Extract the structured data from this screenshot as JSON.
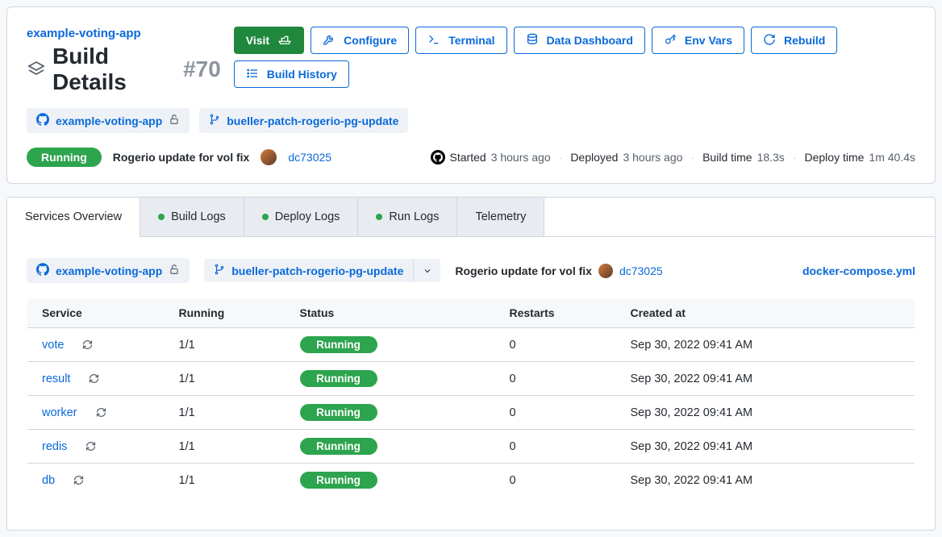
{
  "header": {
    "app_name": "example-voting-app",
    "title": "Build Details",
    "build_number": "#70"
  },
  "actions": {
    "visit": "Visit",
    "configure": "Configure",
    "terminal": "Terminal",
    "data_dashboard": "Data Dashboard",
    "env_vars": "Env Vars",
    "rebuild": "Rebuild",
    "build_history": "Build History"
  },
  "repo": {
    "name": "example-voting-app",
    "branch": "bueller-patch-rogerio-pg-update"
  },
  "status": {
    "label": "Running",
    "commit_message": "Rogerio update for vol fix",
    "commit_hash": "dc73025"
  },
  "meta": {
    "started_label": "Started",
    "started_value": "3 hours ago",
    "deployed_label": "Deployed",
    "deployed_value": "3 hours ago",
    "build_time_label": "Build time",
    "build_time_value": "18.3s",
    "deploy_time_label": "Deploy time",
    "deploy_time_value": "1m 40.4s"
  },
  "tabs": {
    "overview": "Services Overview",
    "build_logs": "Build Logs",
    "deploy_logs": "Deploy Logs",
    "run_logs": "Run Logs",
    "telemetry": "Telemetry"
  },
  "filters": {
    "repo": "example-voting-app",
    "branch": "bueller-patch-rogerio-pg-update",
    "commit_message": "Rogerio update for vol fix",
    "commit_hash": "dc73025",
    "compose_file": "docker-compose.yml"
  },
  "table": {
    "headers": {
      "service": "Service",
      "running": "Running",
      "status": "Status",
      "restarts": "Restarts",
      "created": "Created at"
    },
    "rows": [
      {
        "service": "vote",
        "running": "1/1",
        "status": "Running",
        "restarts": "0",
        "created": "Sep 30, 2022 09:41 AM"
      },
      {
        "service": "result",
        "running": "1/1",
        "status": "Running",
        "restarts": "0",
        "created": "Sep 30, 2022 09:41 AM"
      },
      {
        "service": "worker",
        "running": "1/1",
        "status": "Running",
        "restarts": "0",
        "created": "Sep 30, 2022 09:41 AM"
      },
      {
        "service": "redis",
        "running": "1/1",
        "status": "Running",
        "restarts": "0",
        "created": "Sep 30, 2022 09:41 AM"
      },
      {
        "service": "db",
        "running": "1/1",
        "status": "Running",
        "restarts": "0",
        "created": "Sep 30, 2022 09:41 AM"
      }
    ]
  }
}
